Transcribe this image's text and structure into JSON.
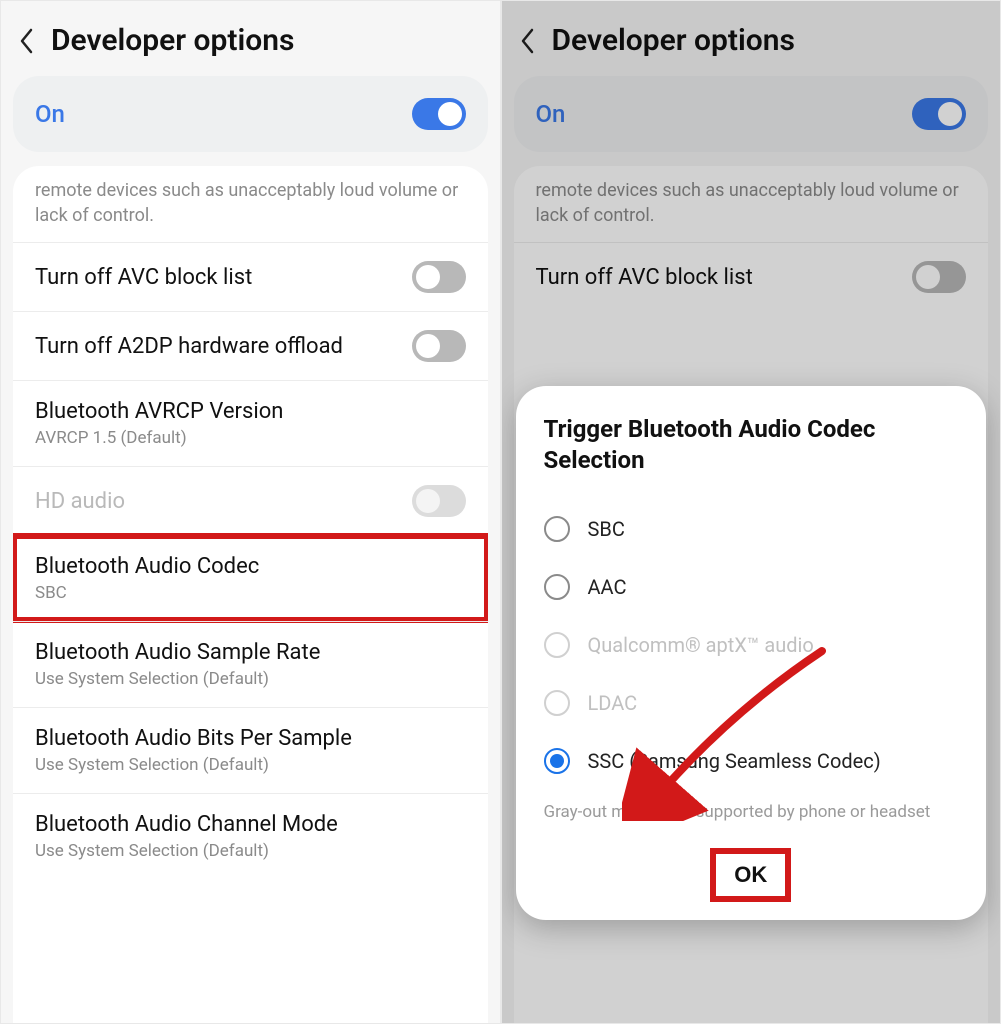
{
  "left": {
    "header": {
      "title": "Developer options"
    },
    "on": {
      "label": "On",
      "enabled": true
    },
    "info": "remote devices such as unacceptably loud volume or lack of control.",
    "rows": [
      {
        "title": "Turn off AVC block list",
        "sub": null,
        "toggle": "off",
        "disabled": false
      },
      {
        "title": "Turn off A2DP hardware offload",
        "sub": null,
        "toggle": "off",
        "disabled": false
      },
      {
        "title": "Bluetooth AVRCP Version",
        "sub": "AVRCP 1.5 (Default)",
        "toggle": null,
        "disabled": false
      },
      {
        "title": "HD audio",
        "sub": null,
        "toggle": "disabled",
        "disabled": true
      },
      {
        "title": "Bluetooth Audio Codec",
        "sub": "SBC",
        "toggle": null,
        "disabled": false,
        "highlight": true
      },
      {
        "title": "Bluetooth Audio Sample Rate",
        "sub": "Use System Selection (Default)",
        "toggle": null,
        "disabled": false
      },
      {
        "title": "Bluetooth Audio Bits Per Sample",
        "sub": "Use System Selection (Default)",
        "toggle": null,
        "disabled": false
      },
      {
        "title": "Bluetooth Audio Channel Mode",
        "sub": "Use System Selection (Default)",
        "toggle": null,
        "disabled": false
      }
    ]
  },
  "right": {
    "header": {
      "title": "Developer options"
    },
    "on": {
      "label": "On",
      "enabled": true
    },
    "info": "remote devices such as unacceptably loud volume or lack of control.",
    "rows": [
      {
        "title": "Turn off AVC block list",
        "sub": null,
        "toggle": "off",
        "disabled": false
      }
    ],
    "dialog": {
      "title": "Trigger Bluetooth Audio Codec Selection",
      "options": [
        {
          "label": "SBC",
          "state": "unselected"
        },
        {
          "label": "AAC",
          "state": "unselected"
        },
        {
          "label": "Qualcomm® aptX™ audio",
          "state": "disabled"
        },
        {
          "label": "LDAC",
          "state": "disabled"
        },
        {
          "label": "SSC (Samsung Seamless Codec)",
          "state": "selected"
        }
      ],
      "note": "Gray-out means not supported by phone or headset",
      "ok": "OK"
    }
  }
}
